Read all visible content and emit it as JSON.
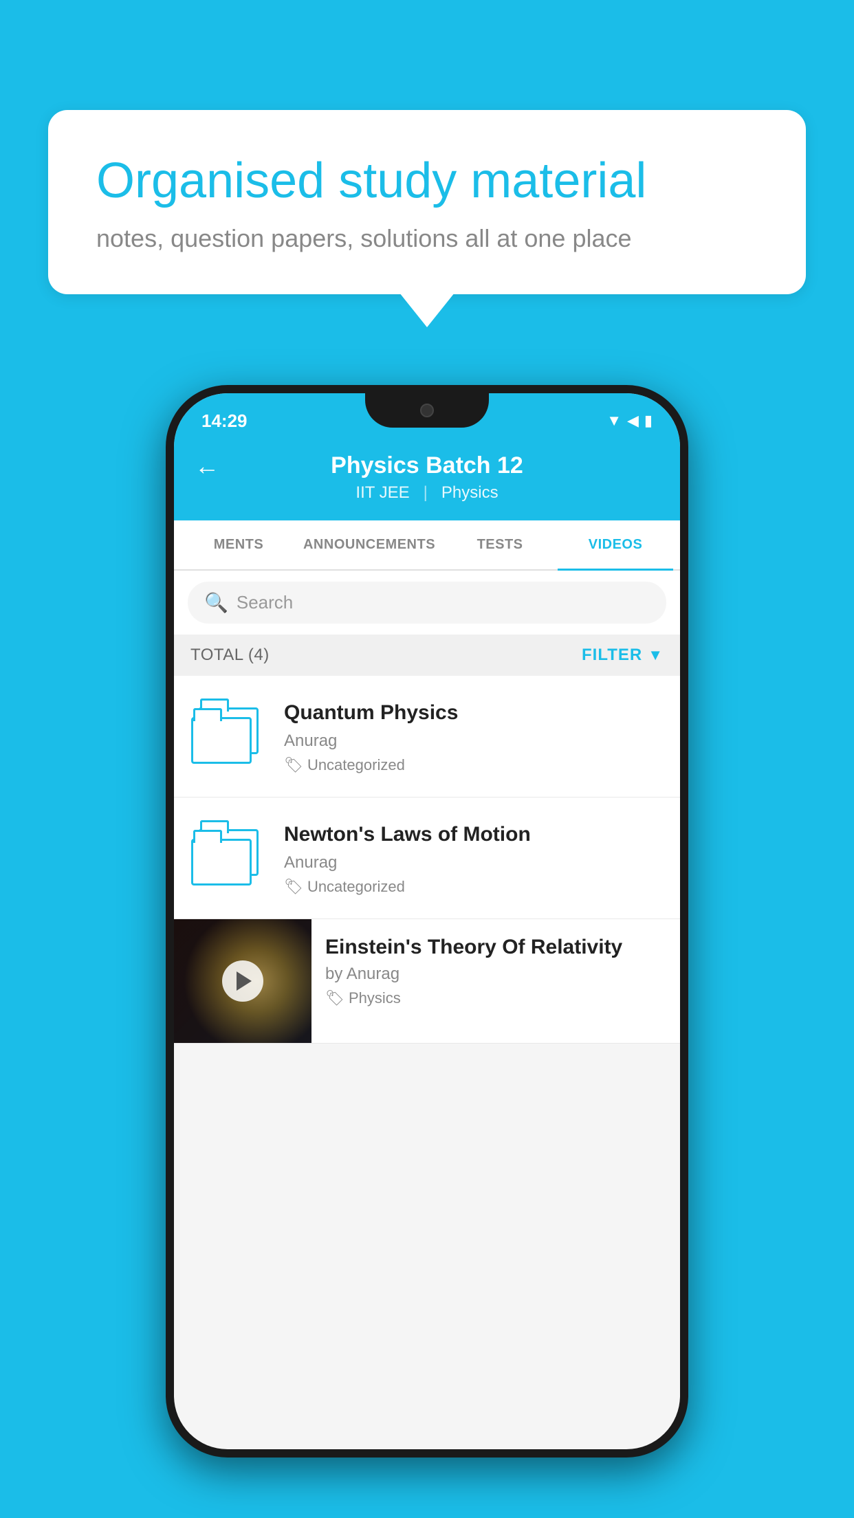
{
  "background": {
    "color": "#1bbde8"
  },
  "speech_bubble": {
    "title": "Organised study material",
    "subtitle": "notes, question papers, solutions all at one place"
  },
  "phone": {
    "status_bar": {
      "time": "14:29"
    },
    "app_bar": {
      "title": "Physics Batch 12",
      "subtitle1": "IIT JEE",
      "subtitle2": "Physics",
      "back_label": "←"
    },
    "tabs": [
      {
        "label": "MENTS",
        "active": false
      },
      {
        "label": "ANNOUNCEMENTS",
        "active": false
      },
      {
        "label": "TESTS",
        "active": false
      },
      {
        "label": "VIDEOS",
        "active": true
      }
    ],
    "search": {
      "placeholder": "Search"
    },
    "filter_row": {
      "total_label": "TOTAL (4)",
      "filter_label": "FILTER"
    },
    "videos": [
      {
        "title": "Quantum Physics",
        "author": "Anurag",
        "tag": "Uncategorized",
        "type": "folder"
      },
      {
        "title": "Newton's Laws of Motion",
        "author": "Anurag",
        "tag": "Uncategorized",
        "type": "folder"
      },
      {
        "title": "Einstein's Theory Of Relativity",
        "author": "by Anurag",
        "tag": "Physics",
        "type": "video"
      }
    ]
  }
}
